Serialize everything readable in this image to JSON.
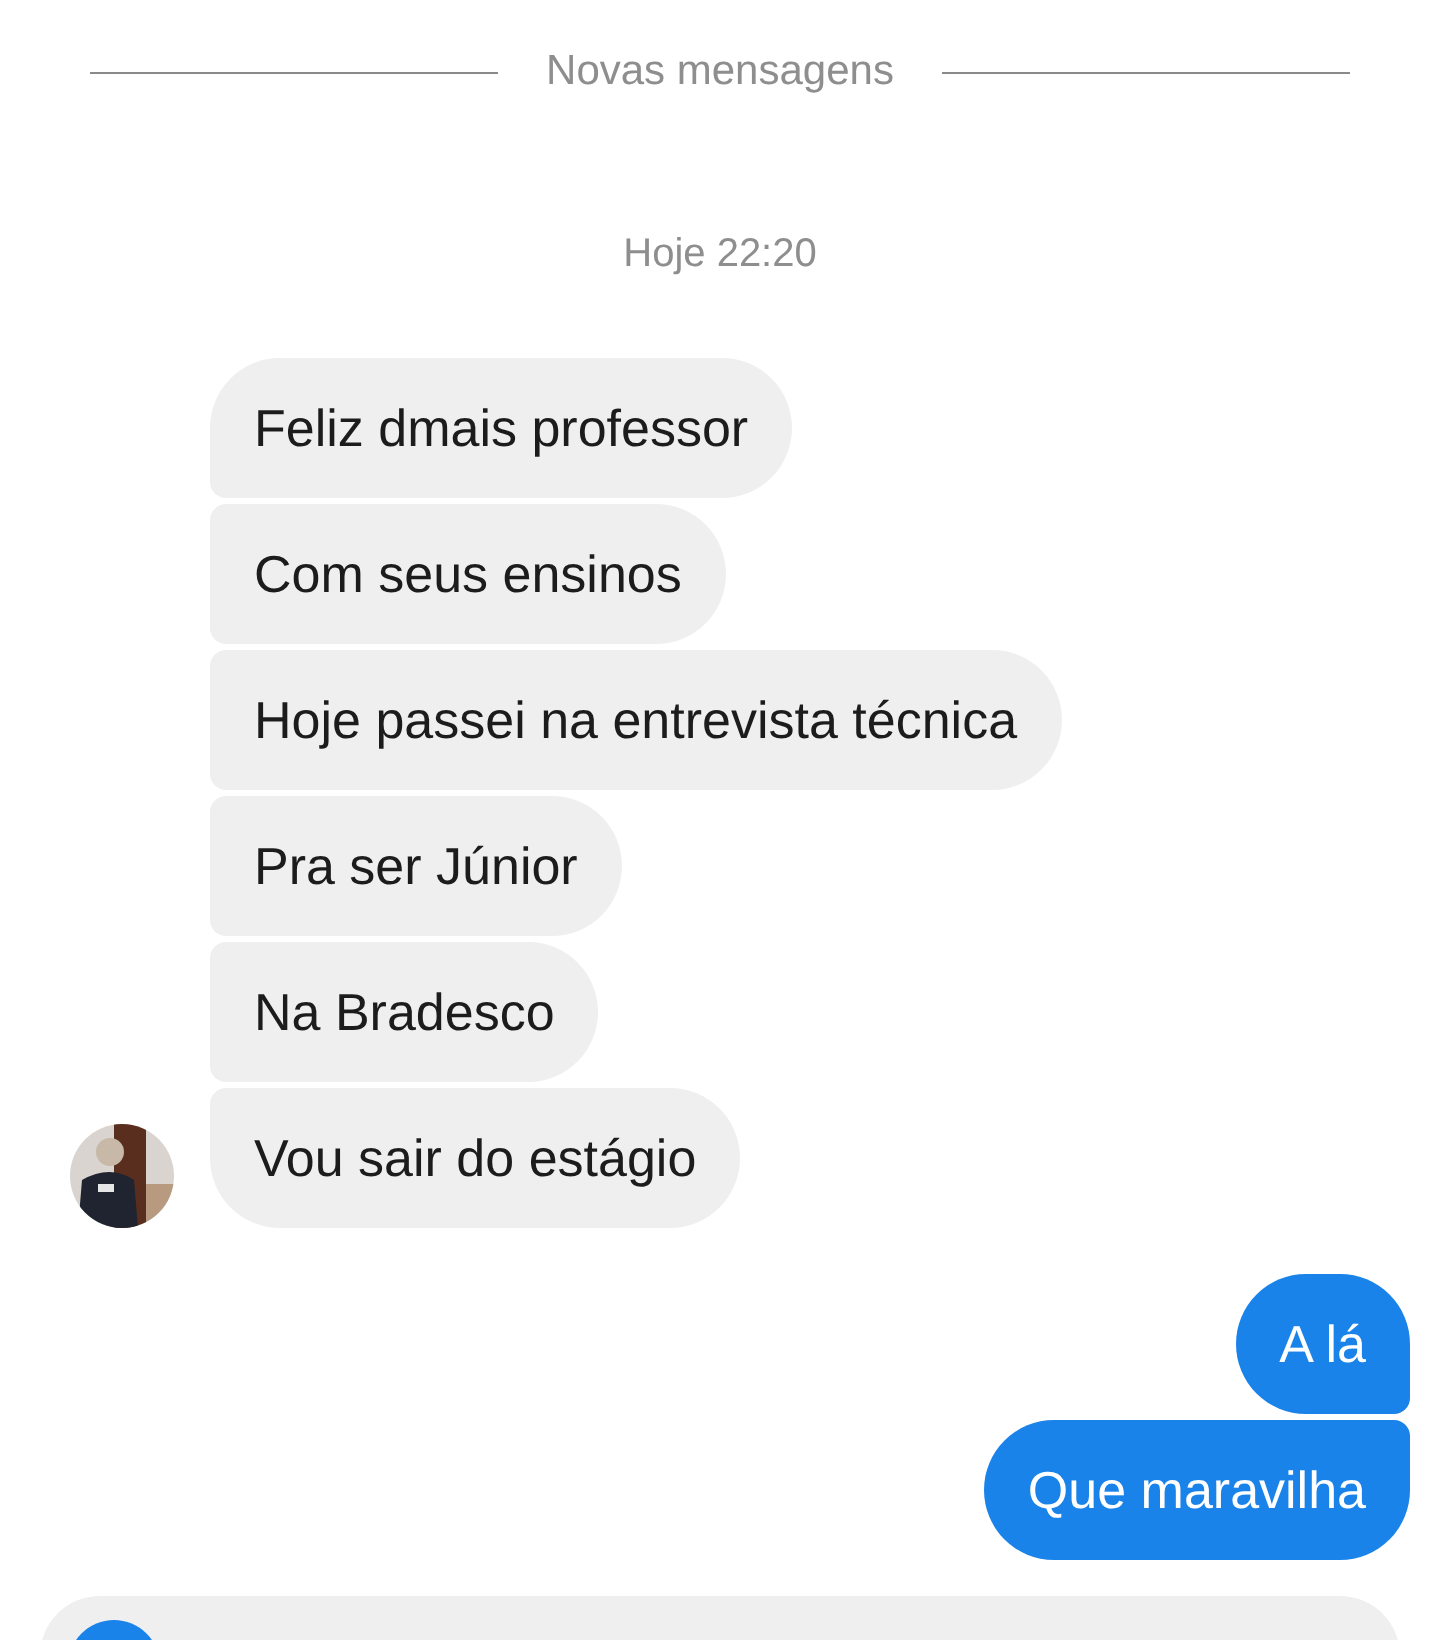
{
  "divider": {
    "label": "Novas mensagens"
  },
  "timestamp": "Hoje 22:20",
  "messages": [
    {
      "text": "Feliz dmais professor",
      "kind": "received"
    },
    {
      "text": "Com seus ensinos",
      "kind": "received"
    },
    {
      "text": "Hoje passei na entrevista técnica",
      "kind": "received"
    },
    {
      "text": "Pra ser Júnior",
      "kind": "received"
    },
    {
      "text": "Na Bradesco",
      "kind": "received"
    },
    {
      "text": "Vou sair do estágio",
      "kind": "received"
    },
    {
      "text": "A lá",
      "kind": "sent"
    },
    {
      "text": "Que maravilha",
      "kind": "sent"
    }
  ]
}
